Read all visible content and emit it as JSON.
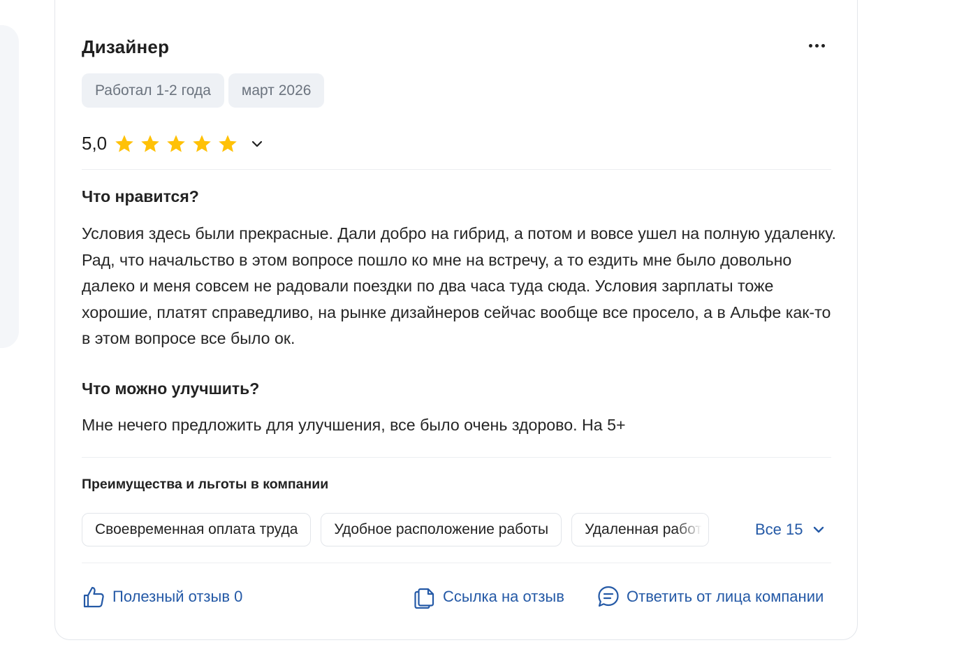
{
  "review": {
    "title": "Дизайнер",
    "tags": [
      "Работал 1-2 года",
      "март 2026"
    ],
    "rating": {
      "value_text": "5,0",
      "stars": 5,
      "max_stars": 5
    },
    "likes": {
      "heading": "Что нравится?",
      "text": "Условия здесь были прекрасные. Дали добро на гибрид, а потом и вовсе ушел на полную удаленку. Рад, что начальство в этом вопросе пошло ко мне на встречу, а то ездить мне было довольно далеко и меня совсем не радовали поездки по два часа туда сюда. Условия зарплаты тоже хорошие, платят справедливо, на рынке дизайнеров сейчас вообще все просело, а в Альфе как-то в этом вопросе все было ок."
    },
    "improve": {
      "heading": "Что можно улучшить?",
      "text": "Мне нечего предложить для улучшения, все было очень здорово. На 5+"
    },
    "benefits": {
      "heading": "Преимущества и льготы в компании",
      "chips": [
        "Своевременная оплата труда",
        "Удобное расположение работы",
        "Удаленная работа"
      ],
      "all_label": "Все 15"
    },
    "actions": {
      "helpful_label": "Полезный отзыв 0",
      "link_label": "Ссылка на отзыв",
      "reply_label": "Ответить от лица компании"
    }
  },
  "colors": {
    "link": "#2459a6",
    "star": "#ffc107",
    "tag_bg": "#eef1f5",
    "primary_button": "#0a6cff"
  },
  "icons": {
    "more": "more-dots-icon",
    "expand": "chevron-down-icon",
    "helpful": "thumbs-up-icon",
    "link": "copy-link-icon",
    "reply": "chat-bubble-icon"
  }
}
